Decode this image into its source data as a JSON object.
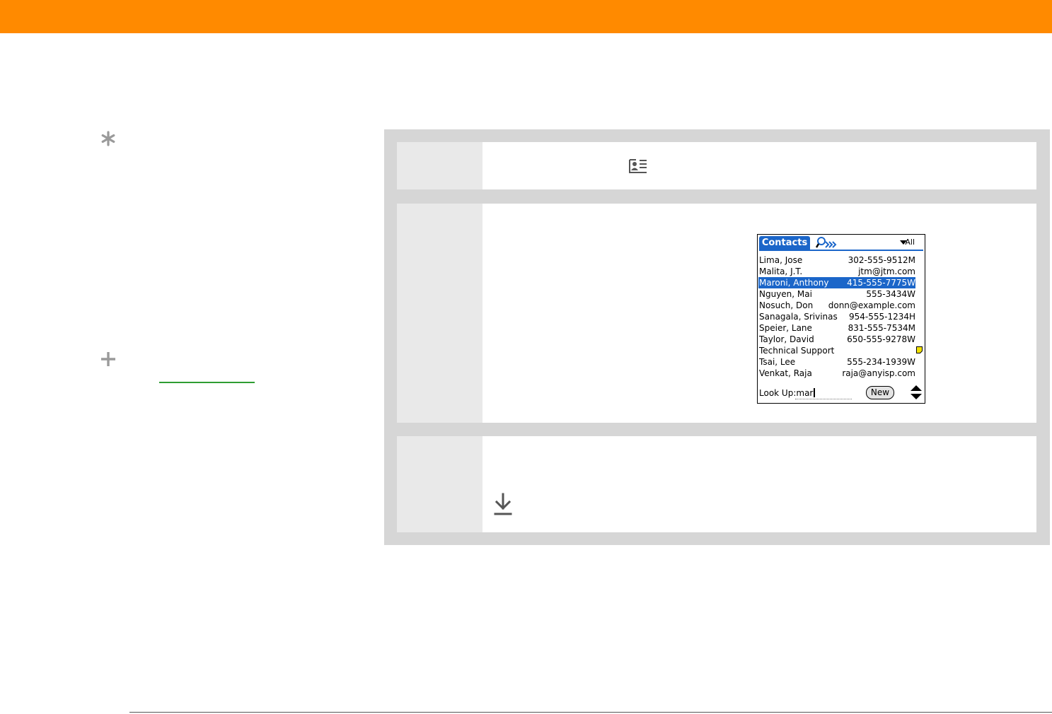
{
  "colors": {
    "header_bar": "#ff8a00",
    "panel_bg": "#d6d6d6",
    "step_number_col": "#e9e9e9",
    "link_green": "#2e9d32",
    "palm_blue": "#1b66c9"
  },
  "icons": {
    "tip": "asterisk-icon",
    "more_info": "plus-icon",
    "contacts_app": "contacts-icon",
    "done": "down-arrow-icon"
  },
  "contacts_screen": {
    "tab_title": "Contacts",
    "category": "All",
    "rows": [
      {
        "name": "Lima, Jose",
        "value": "302-555-9512M"
      },
      {
        "name": "Malita, J.T.",
        "value": "jtm@jtm.com"
      },
      {
        "name": "Maroni, Anthony",
        "value": "415-555-7775W"
      },
      {
        "name": "Nguyen, Mai",
        "value": "555-3434W"
      },
      {
        "name": "Nosuch, Don",
        "value": "donn@example.com"
      },
      {
        "name": "Sanagala, Srivinas",
        "value": "954-555-1234H"
      },
      {
        "name": "Speier, Lane",
        "value": "831-555-7534M"
      },
      {
        "name": "Taylor, David",
        "value": "650-555-9278W"
      },
      {
        "name": "Technical Support",
        "value": ""
      },
      {
        "name": "Tsai, Lee",
        "value": "555-234-1939W"
      },
      {
        "name": "Venkat, Raja",
        "value": "raja@anyisp.com"
      }
    ],
    "selected_row": "Maroni, Anthony",
    "lookup_label": "Look Up:",
    "lookup_value": "mar",
    "new_button": "New"
  }
}
